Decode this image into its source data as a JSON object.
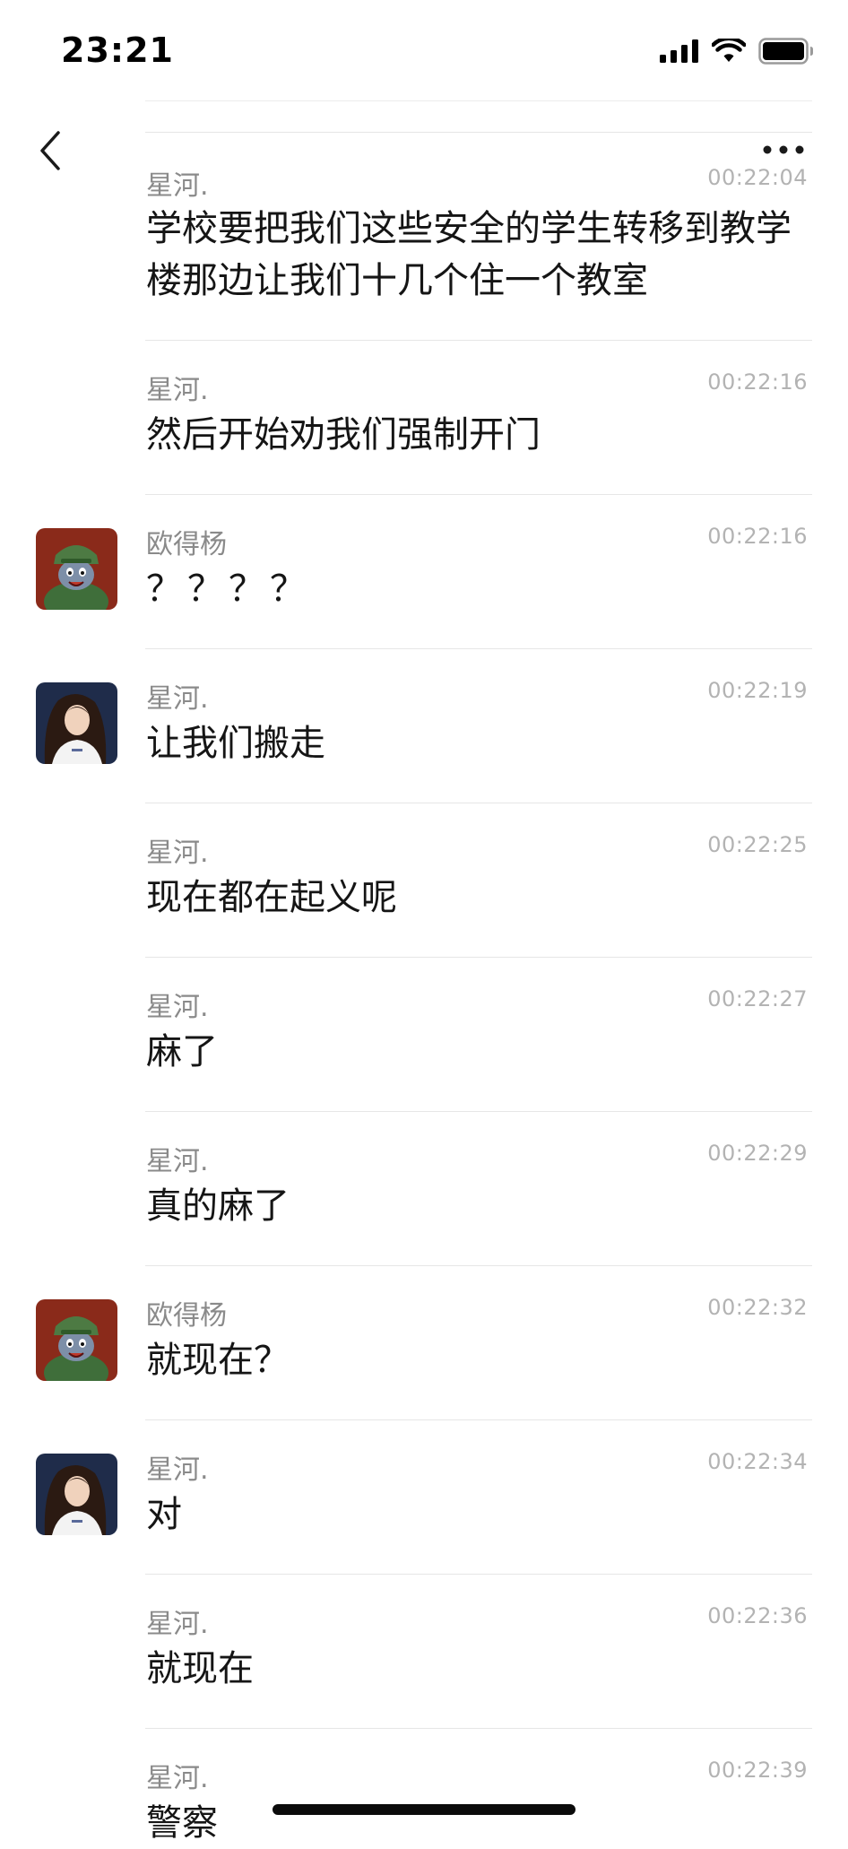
{
  "status_bar": {
    "time": "23:21"
  },
  "header": {
    "back_icon": "chevron-left-icon",
    "more_icon": "ellipsis-icon"
  },
  "messages": [
    {
      "sender": "星河.",
      "time": "00:22:04",
      "text": "学校要把我们这些安全的学生转移到教学楼那边让我们十几个住一个教室",
      "avatar": ""
    },
    {
      "sender": "星河.",
      "time": "00:22:16",
      "text": "然后开始劝我们强制开门",
      "avatar": ""
    },
    {
      "sender": "欧得杨",
      "time": "00:22:16",
      "text": "？？？？",
      "avatar": "cartoon-cat-avatar"
    },
    {
      "sender": "星河.",
      "time": "00:22:19",
      "text": "让我们搬走",
      "avatar": "girl-portrait-avatar"
    },
    {
      "sender": "星河.",
      "time": "00:22:25",
      "text": "现在都在起义呢",
      "avatar": ""
    },
    {
      "sender": "星河.",
      "time": "00:22:27",
      "text": "麻了",
      "avatar": ""
    },
    {
      "sender": "星河.",
      "time": "00:22:29",
      "text": "真的麻了",
      "avatar": ""
    },
    {
      "sender": "欧得杨",
      "time": "00:22:32",
      "text": "就现在？",
      "avatar": "cartoon-cat-avatar"
    },
    {
      "sender": "星河.",
      "time": "00:22:34",
      "text": "对",
      "avatar": "girl-portrait-avatar"
    },
    {
      "sender": "星河.",
      "time": "00:22:36",
      "text": "就现在",
      "avatar": ""
    },
    {
      "sender": "星河.",
      "time": "00:22:39",
      "text": "警察",
      "avatar": ""
    }
  ]
}
